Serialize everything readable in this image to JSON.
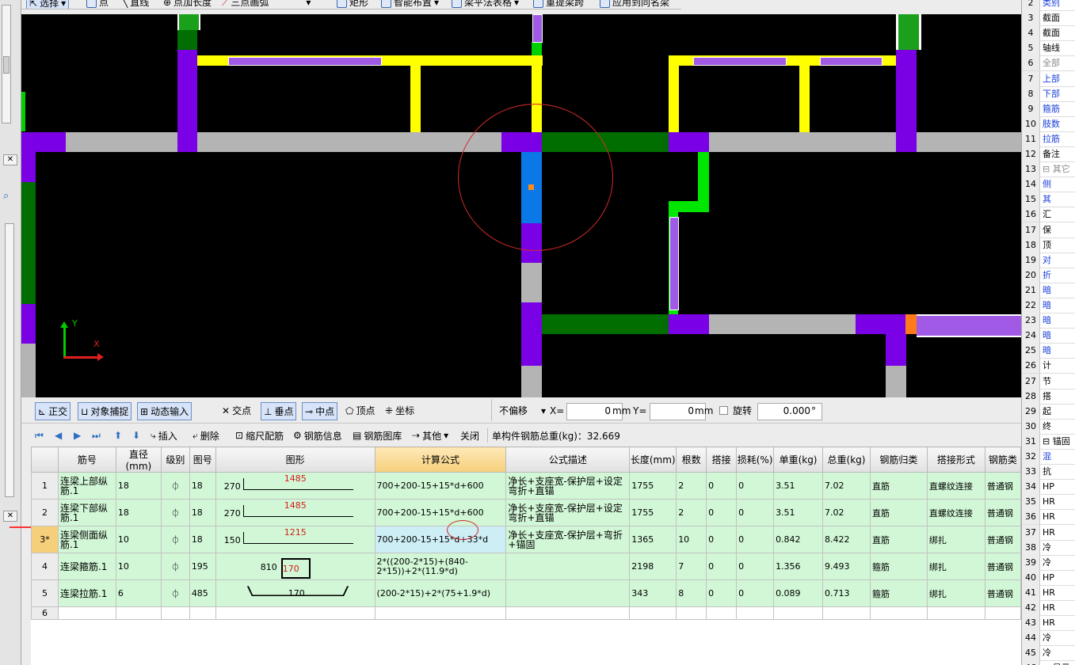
{
  "toolbar": {
    "items": [
      "选择",
      "点",
      "直线",
      "点加长度",
      "三点画弧",
      "矩形",
      "智能布置",
      "梁平法表格",
      "重提梁跨",
      "应用到同名梁"
    ]
  },
  "canvas": {
    "axis_x": "X",
    "axis_y": "Y",
    "colors": {
      "background": "#000000",
      "wall_purple": "#7a00e6",
      "beam_yellow": "#ffff00",
      "beam_green": "#006e00",
      "gray": "#b4b4b4",
      "blue": "#0a78e6",
      "selection_circle": "#d22a2a"
    }
  },
  "snapbar": {
    "ortho": "正交",
    "object_snap": "对象捕捉",
    "dynamic_input": "动态输入",
    "intersection": "交点",
    "perpendicular": "垂点",
    "midpoint": "中点",
    "vertex": "顶点",
    "coordinate": "坐标",
    "offset_mode": "不偏移",
    "x_label": "X=",
    "x_value": "0",
    "x_unit": "mm",
    "y_label": "Y=",
    "y_value": "0",
    "y_unit": "mm",
    "rotate_label": "旋转",
    "rotate_value": "0.000",
    "degree": "°"
  },
  "gridbar": {
    "insert": "插入",
    "delete": "删除",
    "scale_rebar": "缩尺配筋",
    "rebar_info": "钢筋信息",
    "rebar_library": "钢筋图库",
    "other": "其他",
    "close": "关闭",
    "total_weight": "单构件钢筋总重(kg)：32.669"
  },
  "table": {
    "headers": [
      "筋号",
      "直径(mm)",
      "级别",
      "图号",
      "图形",
      "计算公式",
      "公式描述",
      "长度(mm)",
      "根数",
      "搭接",
      "损耗(%)",
      "单重(kg)",
      "总重(kg)",
      "钢筋归类",
      "搭接形式",
      "钢筋类"
    ],
    "rows": [
      {
        "idx": "1",
        "name": "连梁上部纵筋.1",
        "dia": "18",
        "grade": "⏀",
        "fig": "18",
        "shape_left": "270",
        "shape_mid": "1485",
        "formula": "700+200-15+15*d+600",
        "desc": "净长+支座宽-保护层+设定弯折+直锚",
        "length": "1755",
        "count": "2",
        "lap": "0",
        "loss": "0",
        "unit_w": "3.51",
        "total_w": "7.02",
        "category": "直筋",
        "lap_type": "直螺纹连接",
        "rebar_type": "普通钢"
      },
      {
        "idx": "2",
        "name": "连梁下部纵筋.1",
        "dia": "18",
        "grade": "⏀",
        "fig": "18",
        "shape_left": "270",
        "shape_mid": "1485",
        "formula": "700+200-15+15*d+600",
        "desc": "净长+支座宽-保护层+设定弯折+直锚",
        "length": "1755",
        "count": "2",
        "lap": "0",
        "loss": "0",
        "unit_w": "3.51",
        "total_w": "7.02",
        "category": "直筋",
        "lap_type": "直螺纹连接",
        "rebar_type": "普通钢"
      },
      {
        "idx": "3*",
        "name": "连梁侧面纵筋.1",
        "dia": "10",
        "grade": "⏀",
        "fig": "18",
        "shape_left": "150",
        "shape_mid": "1215",
        "formula": "700+200-15+15*d+33*d",
        "desc": "净长+支座宽-保护层+弯折+锚固",
        "length": "1365",
        "count": "10",
        "lap": "0",
        "loss": "0",
        "unit_w": "0.842",
        "total_w": "8.422",
        "category": "直筋",
        "lap_type": "绑扎",
        "rebar_type": "普通钢"
      },
      {
        "idx": "4",
        "name": "连梁箍筋.1",
        "dia": "10",
        "grade": "⏀",
        "fig": "195",
        "shape_left": "810",
        "shape_mid": "170",
        "formula": "2*((200-2*15)+(840-2*15))+2*(11.9*d)",
        "desc": "",
        "length": "2198",
        "count": "7",
        "lap": "0",
        "loss": "0",
        "unit_w": "1.356",
        "total_w": "9.493",
        "category": "箍筋",
        "lap_type": "绑扎",
        "rebar_type": "普通钢"
      },
      {
        "idx": "5",
        "name": "连梁拉筋.1",
        "dia": "6",
        "grade": "⏀",
        "fig": "485",
        "shape_left": "",
        "shape_mid": "170",
        "formula": "(200-2*15)+2*(75+1.9*d)",
        "desc": "",
        "length": "343",
        "count": "8",
        "lap": "0",
        "loss": "0",
        "unit_w": "0.089",
        "total_w": "0.713",
        "category": "箍筋",
        "lap_type": "绑扎",
        "rebar_type": "普通钢"
      }
    ],
    "empty_row_idx": "6"
  },
  "rightpanel": {
    "rows": [
      {
        "n": "2",
        "t": "类别",
        "c": "blue"
      },
      {
        "n": "3",
        "t": "截面",
        "c": ""
      },
      {
        "n": "4",
        "t": "截面",
        "c": ""
      },
      {
        "n": "5",
        "t": "轴线",
        "c": ""
      },
      {
        "n": "6",
        "t": "全部",
        "c": "grey"
      },
      {
        "n": "7",
        "t": "上部",
        "c": "blue"
      },
      {
        "n": "8",
        "t": "下部",
        "c": "blue"
      },
      {
        "n": "9",
        "t": "箍筋",
        "c": "blue"
      },
      {
        "n": "10",
        "t": "肢数",
        "c": "blue"
      },
      {
        "n": "11",
        "t": "拉筋",
        "c": "blue"
      },
      {
        "n": "12",
        "t": "备注",
        "c": ""
      },
      {
        "n": "13",
        "t": "⊟ 其它",
        "c": "grey"
      },
      {
        "n": "14",
        "t": "侧",
        "c": "blue"
      },
      {
        "n": "15",
        "t": "其",
        "c": "blue"
      },
      {
        "n": "16",
        "t": "汇",
        "c": ""
      },
      {
        "n": "17",
        "t": "保",
        "c": ""
      },
      {
        "n": "18",
        "t": "顶",
        "c": ""
      },
      {
        "n": "19",
        "t": "对",
        "c": "blue"
      },
      {
        "n": "20",
        "t": "折",
        "c": "blue"
      },
      {
        "n": "21",
        "t": "暗",
        "c": "blue"
      },
      {
        "n": "22",
        "t": "暗",
        "c": "blue"
      },
      {
        "n": "23",
        "t": "暗",
        "c": "blue"
      },
      {
        "n": "24",
        "t": "暗",
        "c": "blue"
      },
      {
        "n": "25",
        "t": "暗",
        "c": "blue"
      },
      {
        "n": "26",
        "t": "计",
        "c": ""
      },
      {
        "n": "27",
        "t": "节",
        "c": ""
      },
      {
        "n": "28",
        "t": "搭",
        "c": ""
      },
      {
        "n": "29",
        "t": "起",
        "c": ""
      },
      {
        "n": "30",
        "t": "终",
        "c": ""
      },
      {
        "n": "31",
        "t": "⊟ 锚固",
        "c": ""
      },
      {
        "n": "32",
        "t": "混",
        "c": "blue"
      },
      {
        "n": "33",
        "t": "抗",
        "c": ""
      },
      {
        "n": "34",
        "t": "HP",
        "c": ""
      },
      {
        "n": "35",
        "t": "HR",
        "c": ""
      },
      {
        "n": "36",
        "t": "HR",
        "c": ""
      },
      {
        "n": "37",
        "t": "HR",
        "c": ""
      },
      {
        "n": "38",
        "t": "冷",
        "c": ""
      },
      {
        "n": "39",
        "t": "冷",
        "c": ""
      },
      {
        "n": "40",
        "t": "HP",
        "c": ""
      },
      {
        "n": "41",
        "t": "HR",
        "c": ""
      },
      {
        "n": "42",
        "t": "HR",
        "c": ""
      },
      {
        "n": "43",
        "t": "HR",
        "c": ""
      },
      {
        "n": "44",
        "t": "冷",
        "c": ""
      },
      {
        "n": "45",
        "t": "冷",
        "c": ""
      },
      {
        "n": "46",
        "t": "⊞ 显示",
        "c": ""
      }
    ]
  }
}
